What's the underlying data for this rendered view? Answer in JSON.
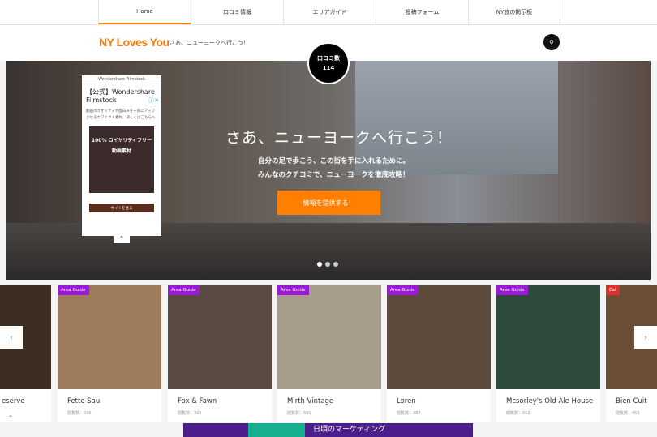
{
  "nav": {
    "items": [
      {
        "label": "Home",
        "active": true
      },
      {
        "label": "口コミ情報"
      },
      {
        "label": "エリアガイド"
      },
      {
        "label": "投稿フォーム"
      },
      {
        "label": "NY旅の掲示板"
      }
    ]
  },
  "header": {
    "logo": "NY Loves You",
    "tagline": "さあ、ニューヨークへ行こう！",
    "search_icon": "search-icon"
  },
  "badge": {
    "label": "口コミ数",
    "count": "114"
  },
  "hero": {
    "title": "さあ、ニューヨークへ行こう！",
    "line1": "自分の足で歩こう、この街を手に入れるために。",
    "line2": "みんなのクチコミで、ニューヨークを徹底攻略！",
    "cta": "情報を提供する！",
    "slides": 3,
    "active_slide": 1
  },
  "ad": {
    "source": "Wondershare Filmstock",
    "title": "【公式】Wondershare Filmstock",
    "desc": "動画のクオリティや面白みを一気にアップさせるエフェクト素材、詳しくはこちらへ",
    "image_text1": "100% ロイヤリティフリー",
    "image_text2": "動画素材",
    "button": "サイトを見る"
  },
  "cards": [
    {
      "name": "eserve",
      "views": "",
      "tag": ""
    },
    {
      "name": "Fette Sau",
      "views": "閲覧数：536",
      "tag": "Area Guide"
    },
    {
      "name": "Fox & Fawn",
      "views": "閲覧数：395",
      "tag": "Area Guide"
    },
    {
      "name": "Mirth Vintage",
      "views": "閲覧数：691",
      "tag": "Area Guide"
    },
    {
      "name": "Loren",
      "views": "閲覧数：387",
      "tag": "Area Guide"
    },
    {
      "name": "Mcsorley's Old Ale House",
      "views": "閲覧数：552",
      "tag": "Area Guide"
    },
    {
      "name": "Bien Cuit",
      "views": "閲覧数：469",
      "tag": "Eat"
    }
  ],
  "bottom_ad": {
    "text": "日頃のマーケティング"
  }
}
